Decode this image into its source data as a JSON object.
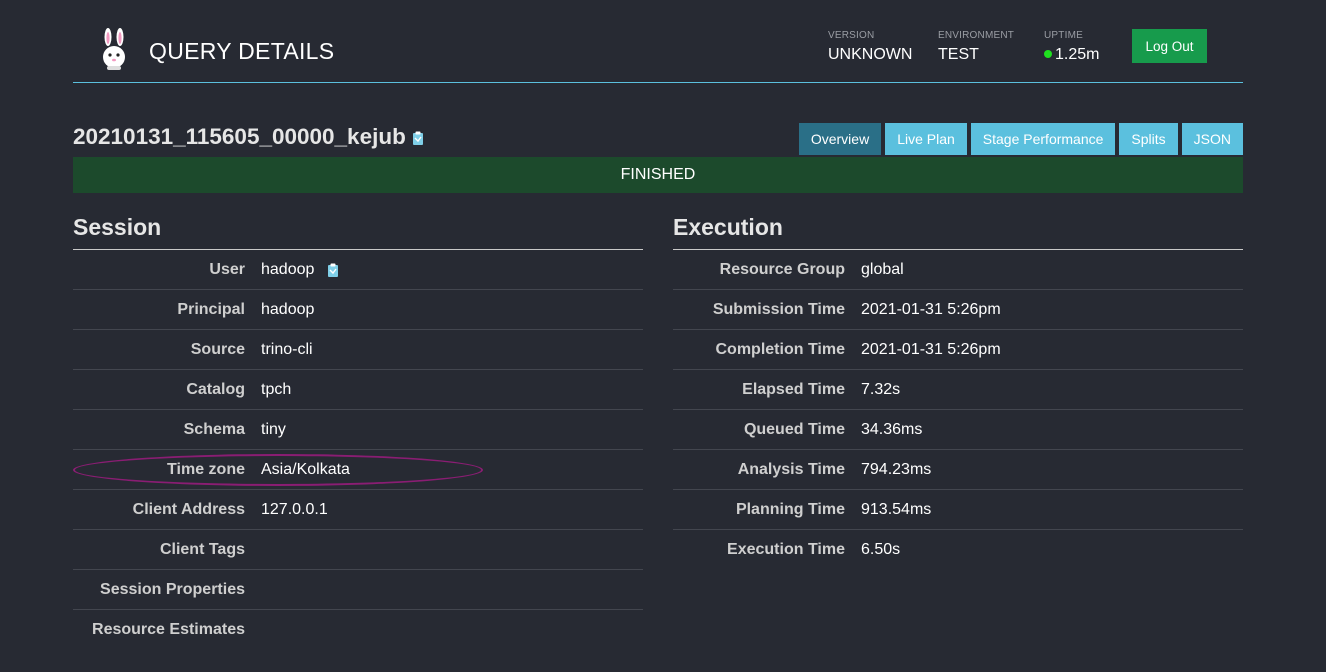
{
  "header": {
    "title": "QUERY DETAILS",
    "version_label": "VERSION",
    "version_value": "UNKNOWN",
    "environment_label": "ENVIRONMENT",
    "environment_value": "TEST",
    "uptime_label": "UPTIME",
    "uptime_value": "1.25m",
    "logout_label": "Log Out"
  },
  "query": {
    "id": "20210131_115605_00000_kejub",
    "state": "FINISHED"
  },
  "tabs": [
    {
      "label": "Overview",
      "active": true
    },
    {
      "label": "Live Plan",
      "active": false
    },
    {
      "label": "Stage Performance",
      "active": false
    },
    {
      "label": "Splits",
      "active": false
    },
    {
      "label": "JSON",
      "active": false
    }
  ],
  "session": {
    "title": "Session",
    "rows": [
      {
        "label": "User",
        "value": "hadoop"
      },
      {
        "label": "Principal",
        "value": "hadoop"
      },
      {
        "label": "Source",
        "value": "trino-cli"
      },
      {
        "label": "Catalog",
        "value": "tpch"
      },
      {
        "label": "Schema",
        "value": "tiny"
      },
      {
        "label": "Time zone",
        "value": "Asia/Kolkata"
      },
      {
        "label": "Client Address",
        "value": "127.0.0.1"
      },
      {
        "label": "Client Tags",
        "value": ""
      },
      {
        "label": "Session Properties",
        "value": ""
      },
      {
        "label": "Resource Estimates",
        "value": ""
      }
    ]
  },
  "execution": {
    "title": "Execution",
    "rows": [
      {
        "label": "Resource Group",
        "value": "global"
      },
      {
        "label": "Submission Time",
        "value": "2021-01-31 5:26pm"
      },
      {
        "label": "Completion Time",
        "value": "2021-01-31 5:26pm"
      },
      {
        "label": "Elapsed Time",
        "value": "7.32s"
      },
      {
        "label": "Queued Time",
        "value": "34.36ms"
      },
      {
        "label": "Analysis Time",
        "value": "794.23ms"
      },
      {
        "label": "Planning Time",
        "value": "913.54ms"
      },
      {
        "label": "Execution Time",
        "value": "6.50s"
      }
    ]
  },
  "colors": {
    "background": "#272a33",
    "accent": "#5bc0de",
    "active_tab": "#2a6f87",
    "finished": "#1c4a2c",
    "logout": "#179b4c",
    "uptime_dot": "#1fe01f",
    "highlight": "#8a1d73"
  },
  "icons": {
    "logo": "bunny-logo-icon",
    "copy": "clipboard-copy-icon",
    "status": "status-dot-icon"
  }
}
